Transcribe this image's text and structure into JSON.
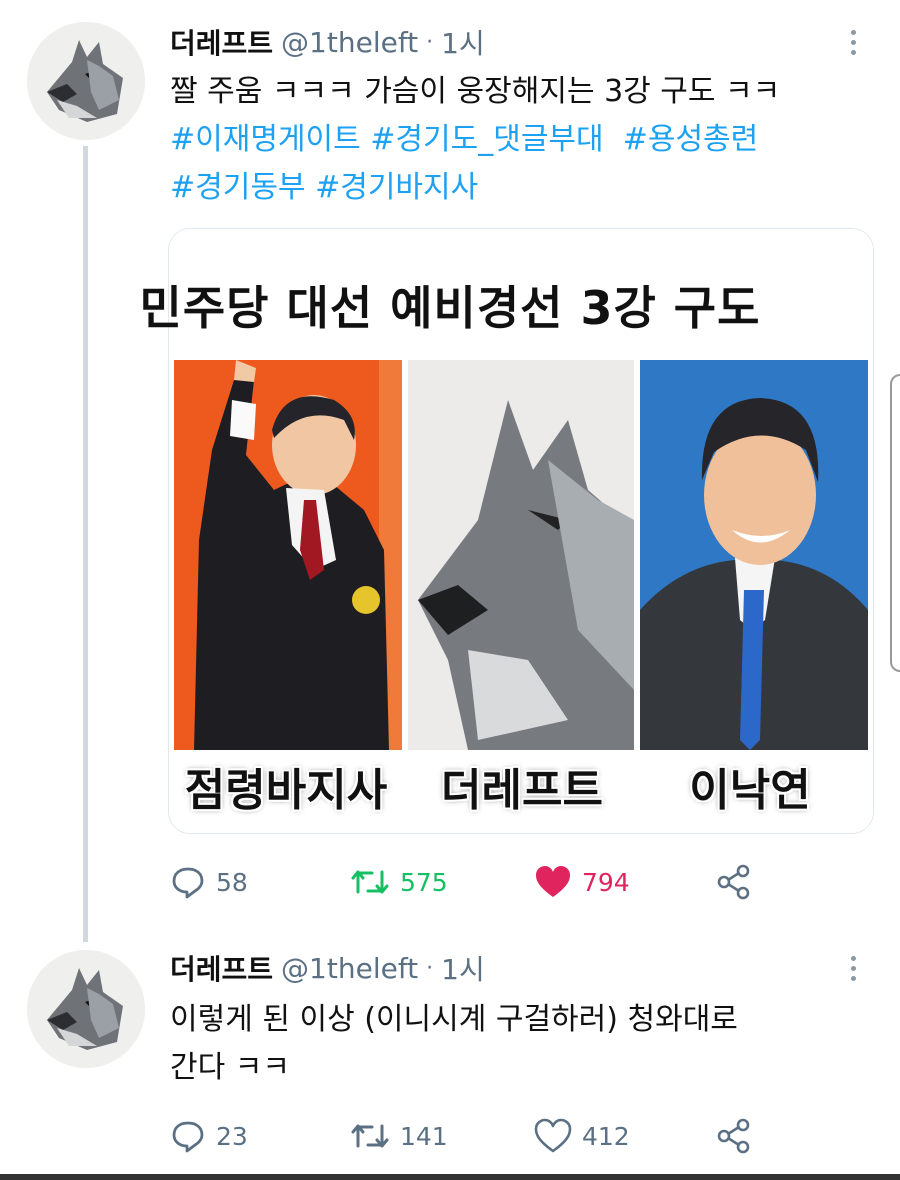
{
  "tweets": [
    {
      "name": "더레프트",
      "handle": "@1theleft",
      "separator": "·",
      "time": "1시",
      "text_plain": "짤 주움 ㅋㅋㅋ 가슴이 웅장해지는 3강 구도 ㅋㅋ",
      "hashtags": [
        "#이재명게이트",
        "#경기도_댓글부대",
        "#용성총련",
        "#경기동부",
        "#경기바지사"
      ],
      "media": {
        "title": "민주당 대선 예비경선 3강 구도",
        "captions": [
          "점령바지사",
          "더레프트",
          "이낙연"
        ]
      },
      "stats": {
        "replies": "58",
        "retweets": "575",
        "likes": "794"
      }
    },
    {
      "name": "더레프트",
      "handle": "@1theleft",
      "separator": "·",
      "time": "1시",
      "text_line1": "이렇게 된 이상 (이니시계 구걸하러) 청와대로",
      "text_line2": "간다 ㅋㅋ",
      "stats": {
        "replies": "23",
        "retweets": "141",
        "likes": "412"
      }
    }
  ],
  "colors": {
    "hashtag": "#1da1f2",
    "retweet_active": "#17bf63",
    "like_active": "#e0245e",
    "muted": "#5b7083"
  },
  "icons": [
    "reply-icon",
    "retweet-icon",
    "like-icon",
    "share-icon",
    "more-icon"
  ]
}
